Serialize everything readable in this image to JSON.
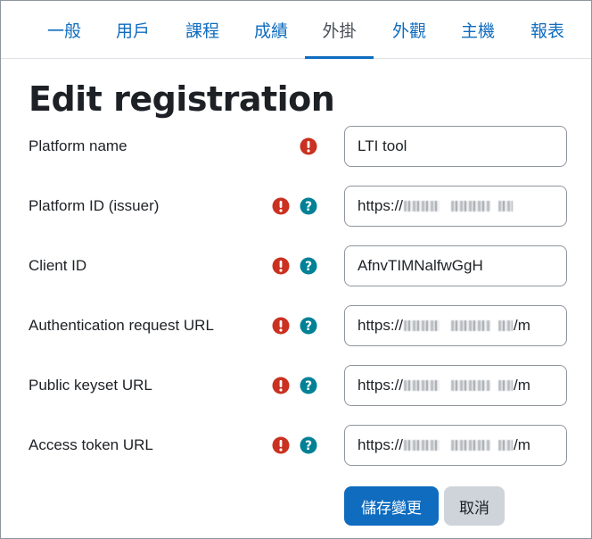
{
  "tabs": [
    {
      "label": "一般"
    },
    {
      "label": "用戶"
    },
    {
      "label": "課程"
    },
    {
      "label": "成績"
    },
    {
      "label": "外掛",
      "active": true
    },
    {
      "label": "外觀"
    },
    {
      "label": "主機"
    },
    {
      "label": "報表"
    }
  ],
  "page_title": "Edit registration",
  "form": {
    "platform_name": {
      "label": "Platform name",
      "value": "LTI tool"
    },
    "platform_id": {
      "label": "Platform ID (issuer)",
      "value_prefix": "https://"
    },
    "client_id": {
      "label": "Client ID",
      "value": "AfnvTIMNalfwGgH"
    },
    "auth_url": {
      "label": "Authentication request URL",
      "value_prefix": "https://",
      "value_suffix": "/m"
    },
    "keyset_url": {
      "label": "Public keyset URL",
      "value_prefix": "https://",
      "value_suffix": "/m"
    },
    "token_url": {
      "label": "Access token URL",
      "value_prefix": "https://",
      "value_suffix": "/m"
    }
  },
  "buttons": {
    "save": "儲存變更",
    "cancel": "取消"
  },
  "icons": {
    "required": "exclamation-circle-icon",
    "help": "question-circle-icon"
  },
  "colors": {
    "accent": "#0f6cbf",
    "required": "#ca3120",
    "help": "#008196"
  }
}
